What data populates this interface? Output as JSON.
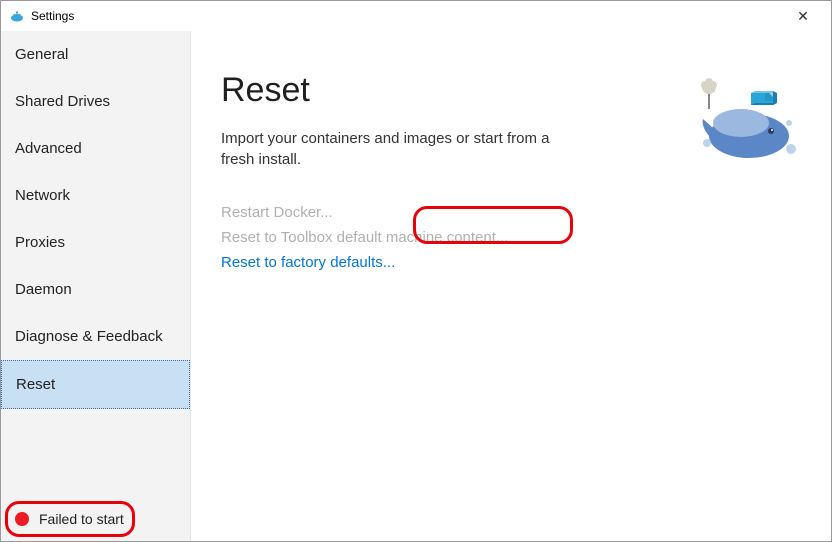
{
  "window": {
    "title": "Settings"
  },
  "sidebar": {
    "items": [
      {
        "label": "General"
      },
      {
        "label": "Shared Drives"
      },
      {
        "label": "Advanced"
      },
      {
        "label": "Network"
      },
      {
        "label": "Proxies"
      },
      {
        "label": "Daemon"
      },
      {
        "label": "Diagnose & Feedback"
      },
      {
        "label": "Reset"
      }
    ],
    "selected_index": 7
  },
  "status": {
    "text": "Failed to start",
    "dot_color": "#ed1c24"
  },
  "content": {
    "heading": "Reset",
    "subheading": "Import your containers and images or start from a fresh install.",
    "actions": [
      {
        "label": "Restart Docker...",
        "enabled": false
      },
      {
        "label": "Reset to Toolbox default machine content...",
        "enabled": false
      },
      {
        "label": "Reset to factory defaults...",
        "enabled": true
      }
    ]
  },
  "colors": {
    "accent": "#0078d7",
    "annotation": "#e6040a"
  }
}
